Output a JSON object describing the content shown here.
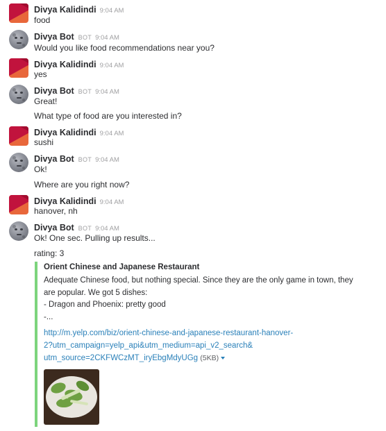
{
  "messages": [
    {
      "sender": "Divya Kalidindi",
      "time": "9:04 AM",
      "is_bot": false,
      "lines": [
        "food"
      ]
    },
    {
      "sender": "Divya Bot",
      "bot_tag": "BOT",
      "time": "9:04 AM",
      "is_bot": true,
      "lines": [
        "Would you like food recommendations near you?"
      ]
    },
    {
      "sender": "Divya Kalidindi",
      "time": "9:04 AM",
      "is_bot": false,
      "lines": [
        "yes"
      ]
    },
    {
      "sender": "Divya Bot",
      "bot_tag": "BOT",
      "time": "9:04 AM",
      "is_bot": true,
      "lines": [
        "Great!",
        "What type of food are you interested in?"
      ]
    },
    {
      "sender": "Divya Kalidindi",
      "time": "9:04 AM",
      "is_bot": false,
      "lines": [
        "sushi"
      ]
    },
    {
      "sender": "Divya Bot",
      "bot_tag": "BOT",
      "time": "9:04 AM",
      "is_bot": true,
      "lines": [
        "Ok!",
        "Where are you right now?"
      ]
    },
    {
      "sender": "Divya Kalidindi",
      "time": "9:04 AM",
      "is_bot": false,
      "lines": [
        "hanover, nh"
      ]
    },
    {
      "sender": "Divya Bot",
      "bot_tag": "BOT",
      "time": "9:04 AM",
      "is_bot": true,
      "lines": [
        "Ok! One sec. Pulling up results...",
        "rating: 3"
      ]
    }
  ],
  "attachment": {
    "title": "Orient Chinese and Japanese Restaurant",
    "text_lines": [
      "Adequate Chinese food, but nothing special.  Since they are the only game in town, they",
      "are popular.  We got 5 dishes:",
      "- Dragon and Phoenix: pretty good",
      "-..."
    ],
    "link_lines": [
      "http://m.yelp.com/biz/orient-chinese-and-japanese-restaurant-hanover-",
      "2?utm_campaign=yelp_api&utm_medium=api_v2_search&",
      "utm_source=2CKFWCzMT_iryEbgMdyUGg"
    ],
    "file_size": "(5KB)",
    "accent_color": "#7dd47d",
    "link_color": "#2a80b9"
  },
  "icons": {
    "user_avatar": "user-avatar-icon",
    "bot_avatar": "moon-face-icon",
    "expand": "caret-down-icon"
  }
}
